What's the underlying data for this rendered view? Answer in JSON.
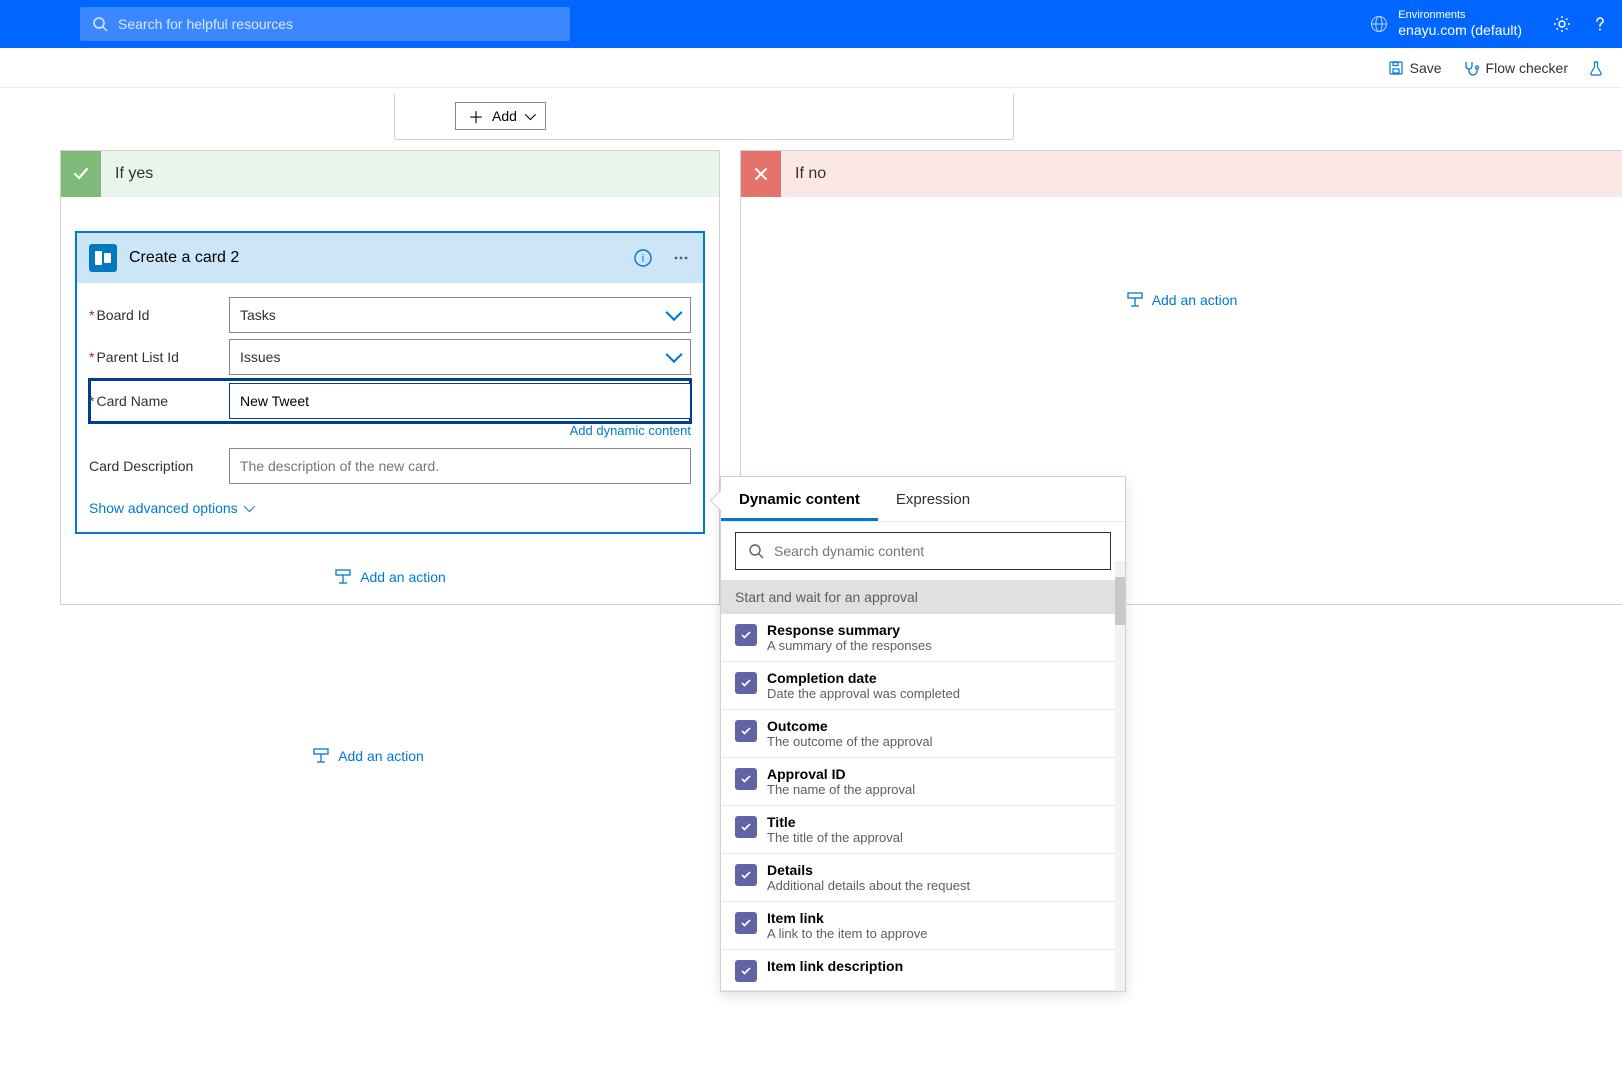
{
  "topbar": {
    "search_placeholder": "Search for helpful resources",
    "environments_label": "Environments",
    "environment_name": "enayu.com (default)"
  },
  "cmdbar": {
    "save": "Save",
    "flow_checker": "Flow checker"
  },
  "condition": {
    "add_button": "Add"
  },
  "branches": {
    "yes_label": "If yes",
    "no_label": "If no",
    "add_action": "Add an action",
    "add_an_a": "Add an a"
  },
  "card": {
    "title": "Create a card 2",
    "fields": {
      "board_id": {
        "label": "Board Id",
        "value": "Tasks"
      },
      "parent_list_id": {
        "label": "Parent List Id",
        "value": "Issues"
      },
      "card_name": {
        "label": "Card Name",
        "value": "New Tweet"
      },
      "card_description": {
        "label": "Card Description",
        "placeholder": "The description of the new card."
      }
    },
    "add_dynamic": "Add dynamic content",
    "advanced_options": "Show advanced options"
  },
  "dyn": {
    "tabs": {
      "dynamic": "Dynamic content",
      "expression": "Expression"
    },
    "search_placeholder": "Search dynamic content",
    "section": "Start and wait for an approval",
    "items": [
      {
        "title": "Response summary",
        "desc": "A summary of the responses"
      },
      {
        "title": "Completion date",
        "desc": "Date the approval was completed"
      },
      {
        "title": "Outcome",
        "desc": "The outcome of the approval"
      },
      {
        "title": "Approval ID",
        "desc": "The name of the approval"
      },
      {
        "title": "Title",
        "desc": "The title of the approval"
      },
      {
        "title": "Details",
        "desc": "Additional details about the request"
      },
      {
        "title": "Item link",
        "desc": "A link to the item to approve"
      },
      {
        "title": "Item link description",
        "desc": ""
      }
    ]
  },
  "outer": {
    "add_action": "Add an action"
  }
}
